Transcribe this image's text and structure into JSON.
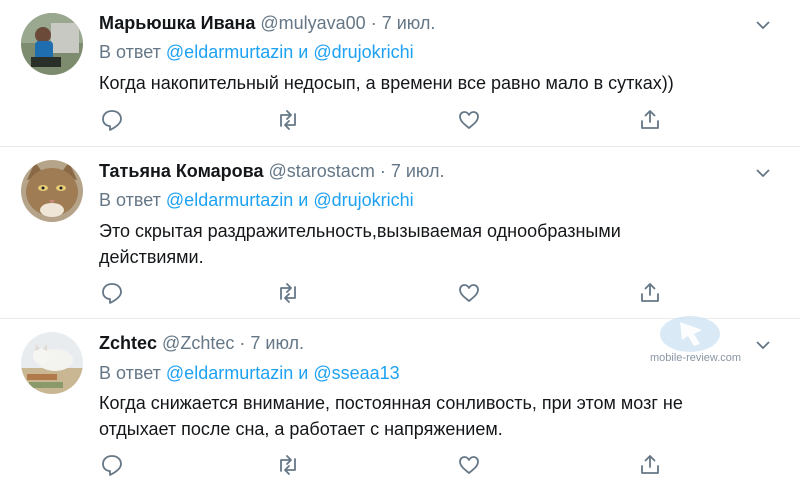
{
  "tweets": [
    {
      "name": "Марьюшка Ивана",
      "handle": "@mulyava00",
      "dot": "·",
      "date": "7 июл.",
      "reply_prefix": "В ответ",
      "reply_user1": "@eldarmurtazin",
      "reply_and": "и",
      "reply_user2": "@drujokrichi",
      "text_lines": [
        "Когда накопительный недосып, а времени все равно мало в сутках))"
      ]
    },
    {
      "name": "Татьяна Комарова",
      "handle": "@starostacm",
      "dot": "·",
      "date": "7 июл.",
      "reply_prefix": "В ответ",
      "reply_user1": "@eldarmurtazin",
      "reply_and": "и",
      "reply_user2": "@drujokrichi",
      "text_lines": [
        "Это скрытая раздражительность,вызываемая однообразными",
        "действиями."
      ]
    },
    {
      "name": "Zchtec",
      "handle": "@Zchtec",
      "dot": "·",
      "date": "7 июл.",
      "reply_prefix": "В ответ",
      "reply_user1": "@eldarmurtazin",
      "reply_and": "и",
      "reply_user2": "@sseaa13",
      "text_lines": [
        "Когда снижается внимание, постоянная сонливость, при этом мозг не",
        "отдыхает после сна, а работает с напряжением."
      ]
    }
  ],
  "watermark": "mobile-review.com",
  "colors": {
    "link": "#1da1f2",
    "muted": "#657786",
    "text": "#14171a",
    "divider": "#e6ecf0"
  },
  "icons": [
    "reply-icon",
    "retweet-icon",
    "like-icon",
    "share-icon",
    "chevron-down-icon"
  ]
}
